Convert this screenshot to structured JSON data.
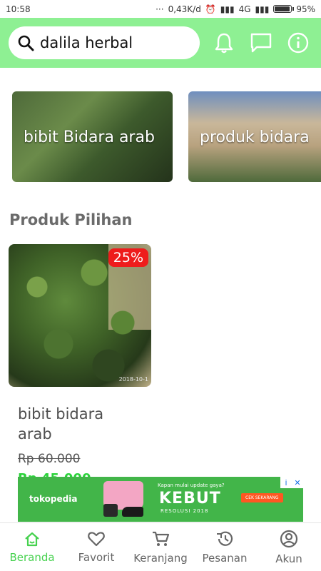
{
  "status": {
    "time": "10:58",
    "speed": "0,43K/d",
    "network": "4G",
    "battery": "95%",
    "battery_level": 0.95
  },
  "header": {
    "search_text": "dalila herbal",
    "icons": [
      "search-icon",
      "bell-icon",
      "chat-icon",
      "info-icon"
    ]
  },
  "categories": [
    {
      "label": "bibit Bidara arab"
    },
    {
      "label": "produk bidara"
    }
  ],
  "section": {
    "title": "Produk Pilihan"
  },
  "product": {
    "discount": "25%",
    "photo_date": "2018-10-1",
    "name": "bibit bidara arab",
    "old_price": "Rp 60.000",
    "new_price": "Rp 45.000"
  },
  "ad": {
    "brand": "tokopedia",
    "tagline": "Kapan mulai update gaya?",
    "headline": "KEBUT",
    "subline": "RESOLUSI 2018",
    "cta": "CEK SEKARANG",
    "info": "i",
    "close": "✕"
  },
  "nav": {
    "items": [
      {
        "label": "Beranda",
        "icon": "home-icon",
        "active": true
      },
      {
        "label": "Favorit",
        "icon": "heart-icon",
        "active": false
      },
      {
        "label": "Keranjang",
        "icon": "cart-icon",
        "active": false
      },
      {
        "label": "Pesanan",
        "icon": "history-icon",
        "active": false
      },
      {
        "label": "Akun",
        "icon": "account-icon",
        "active": false
      }
    ]
  },
  "colors": {
    "header_bg": "#8ef093",
    "accent": "#45d14e",
    "discount": "#ee1c1c",
    "ad_bg": "#42b549"
  }
}
